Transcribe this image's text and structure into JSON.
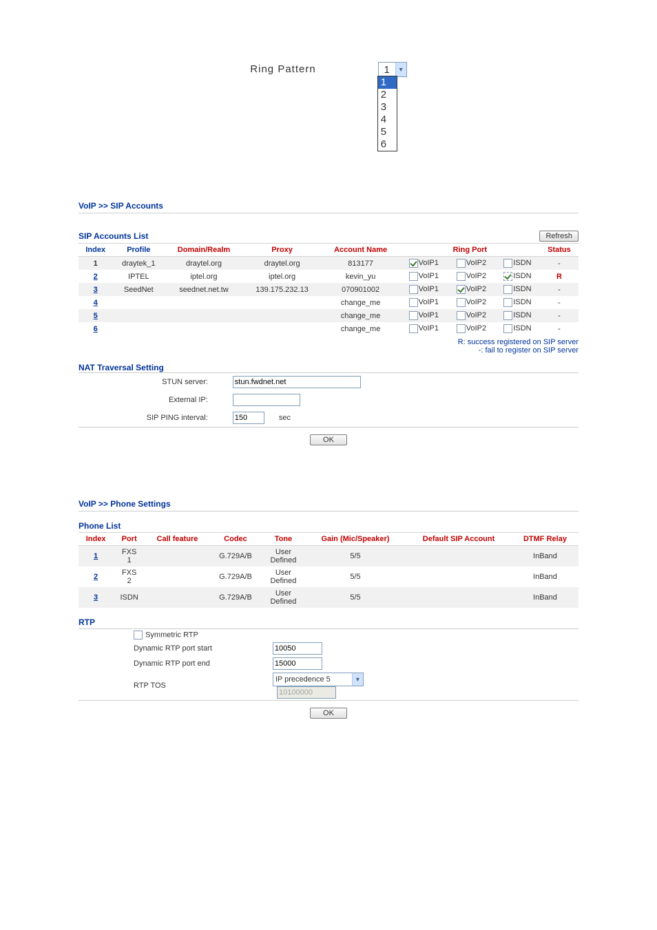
{
  "ring_pattern": {
    "label": "Ring Pattern",
    "current": "1",
    "options": [
      "1",
      "2",
      "3",
      "4",
      "5",
      "6"
    ]
  },
  "breadcrumb1": {
    "a": "VoIP",
    "sep": ">>",
    "b": "SIP Accounts"
  },
  "sip": {
    "list_title": "SIP Accounts List",
    "refresh": "Refresh",
    "cols": {
      "index": "Index",
      "profile": "Profile",
      "domain": "Domain/Realm",
      "proxy": "Proxy",
      "account": "Account Name",
      "ringport": "Ring Port",
      "status": "Status"
    },
    "ports": {
      "voip1": "VoIP1",
      "voip2": "VoIP2",
      "isdn": "ISDN"
    },
    "rows": [
      {
        "idx": "1",
        "profile": "draytek_1",
        "domain": "draytel.org",
        "proxy": "draytel.org",
        "account": "813177",
        "voip1": true,
        "voip2": false,
        "isdn": false,
        "status": "-"
      },
      {
        "idx": "2",
        "profile": "IPTEL",
        "domain": "iptel.org",
        "proxy": "iptel.org",
        "account": "kevin_yu",
        "voip1": false,
        "voip2": false,
        "isdn": true,
        "status": "R",
        "isdn_dotted": true
      },
      {
        "idx": "3",
        "profile": "SeedNet",
        "domain": "seednet.net.tw",
        "proxy": "139.175.232.13",
        "account": "070901002",
        "voip1": false,
        "voip2": true,
        "isdn": false,
        "status": "-"
      },
      {
        "idx": "4",
        "profile": "",
        "domain": "",
        "proxy": "",
        "account": "change_me",
        "voip1": false,
        "voip2": false,
        "isdn": false,
        "status": "-"
      },
      {
        "idx": "5",
        "profile": "",
        "domain": "",
        "proxy": "",
        "account": "change_me",
        "voip1": false,
        "voip2": false,
        "isdn": false,
        "status": "-"
      },
      {
        "idx": "6",
        "profile": "",
        "domain": "",
        "proxy": "",
        "account": "change_me",
        "voip1": false,
        "voip2": false,
        "isdn": false,
        "status": "-"
      }
    ],
    "legend1": "R: success registered on SIP server",
    "legend2": "-: fail to register on SIP server"
  },
  "nat": {
    "title": "NAT Traversal Setting",
    "stun_label": "STUN server:",
    "stun_value": "stun.fwdnet.net",
    "ext_label": "External IP:",
    "ext_value": "",
    "ping_label": "SIP PING interval:",
    "ping_value": "150",
    "ping_unit": "sec"
  },
  "ok_label": "OK",
  "breadcrumb2": {
    "a": "VoIP",
    "sep": ">>",
    "b": "Phone Settings"
  },
  "phone": {
    "title": "Phone List",
    "cols": {
      "index": "Index",
      "port": "Port",
      "callfeature": "Call feature",
      "codec": "Codec",
      "tone": "Tone",
      "gain": "Gain (Mic/Speaker)",
      "defsip": "Default SIP Account",
      "dtmf": "DTMF Relay"
    },
    "rows": [
      {
        "idx": "1",
        "port": "FXS 1",
        "callfeature": "",
        "codec": "G.729A/B",
        "tone": "User Defined",
        "gain": "5/5",
        "defsip": "",
        "dtmf": "InBand"
      },
      {
        "idx": "2",
        "port": "FXS 2",
        "callfeature": "",
        "codec": "G.729A/B",
        "tone": "User Defined",
        "gain": "5/5",
        "defsip": "",
        "dtmf": "InBand"
      },
      {
        "idx": "3",
        "port": "ISDN",
        "callfeature": "",
        "codec": "G.729A/B",
        "tone": "User Defined",
        "gain": "5/5",
        "defsip": "",
        "dtmf": "InBand"
      }
    ]
  },
  "rtp": {
    "title": "RTP",
    "sym_label": "Symmetric RTP",
    "sym_checked": false,
    "start_label": "Dynamic RTP port start",
    "start_value": "10050",
    "end_label": "Dynamic RTP port end",
    "end_value": "15000",
    "tos_label": "RTP TOS",
    "tos_select": "IP precedence 5",
    "tos_raw": "10100000"
  }
}
